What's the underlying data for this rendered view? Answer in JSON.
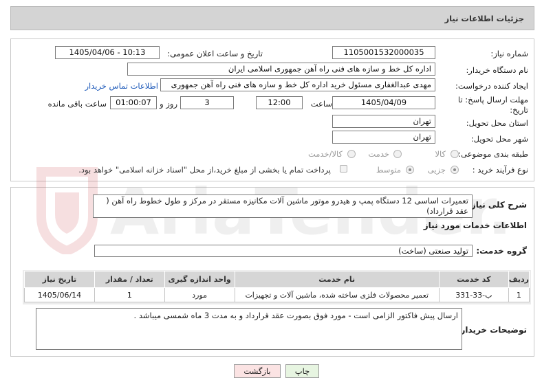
{
  "header": {
    "title": "جزئیات اطلاعات نیاز"
  },
  "fields": {
    "need_number_label": "شماره نیاز:",
    "need_number": "1105001532000035",
    "announce_label": "تاریخ و ساعت اعلان عمومی:",
    "announce_value": "1405/04/06 - 10:13",
    "buyer_org_label": "نام دستگاه خریدار:",
    "buyer_org": "اداره کل خط و سازه های فنی راه آهن جمهوری اسلامی ایران",
    "creator_label": "ایجاد کننده درخواست:",
    "creator": "مهدی عبدالغفاری مسئول خرید اداره کل خط و سازه های فنی راه آهن جمهوری",
    "contact_link": "اطلاعات تماس خریدار",
    "deadline_label": "مهلت ارسال پاسخ: تا تاریخ:",
    "deadline_date": "1405/04/09",
    "time_label": "ساعت",
    "deadline_time": "12:00",
    "days_value": "3",
    "days_label": "روز و",
    "remaining_value": "01:00:07",
    "remaining_label": "ساعت باقی مانده",
    "province_label": "استان محل تحویل:",
    "province": "تهران",
    "city_label": "شهر محل تحویل:",
    "city": "تهران",
    "category_label": "طبقه بندی موضوعی:",
    "category_options": [
      "کالا",
      "خدمت",
      "کالا/خدمت"
    ],
    "category_selected": "خدمت",
    "process_label": "نوع فرآیند خرید :",
    "process_options": [
      "جزیی",
      "متوسط"
    ],
    "process_selected": "جزیی",
    "payment_note": "پرداخت تمام یا بخشی از مبلغ خرید،از محل \"اسناد خزانه اسلامی\" خواهد بود."
  },
  "description": {
    "label": "شرح کلی نیاز:",
    "text": "تعمیرات اساسی 12 دستگاه پمپ و هیدرو موتور ماشین آلات مکانیزه مستقر در مرکز و طول خطوط راه آهن ( عقد قرارداد)"
  },
  "services": {
    "section_title": "اطلاعات خدمات مورد نیاز",
    "group_label": "گروه خدمت:",
    "group_value": "تولید صنعتی (ساخت)",
    "columns": [
      "ردیف",
      "کد خدمت",
      "نام خدمت",
      "واحد اندازه گیری",
      "تعداد / مقدار",
      "تاریخ نیاز"
    ],
    "rows": [
      [
        "1",
        "ب-33-331",
        "تعمیر محصولات فلزی ساخته شده، ماشین آلات و تجهیزات",
        "مورد",
        "1",
        "1405/06/14"
      ]
    ]
  },
  "buyer_notes": {
    "label": "توضیحات خریدار:",
    "text": "ارسال پیش فاکتور الزامی است - مورد فوق بصورت عقد قرارداد و به مدت 3 ماه شمسی میباشد ."
  },
  "buttons": {
    "print": "چاپ",
    "back": "بازگشت"
  },
  "watermark": {
    "text": "AriaTender.net"
  },
  "colors": {
    "header_bg": "#d4d4d4",
    "link": "#1a57b8",
    "print_bg": "#e7f5e1",
    "back_bg": "#fbe3e3"
  }
}
